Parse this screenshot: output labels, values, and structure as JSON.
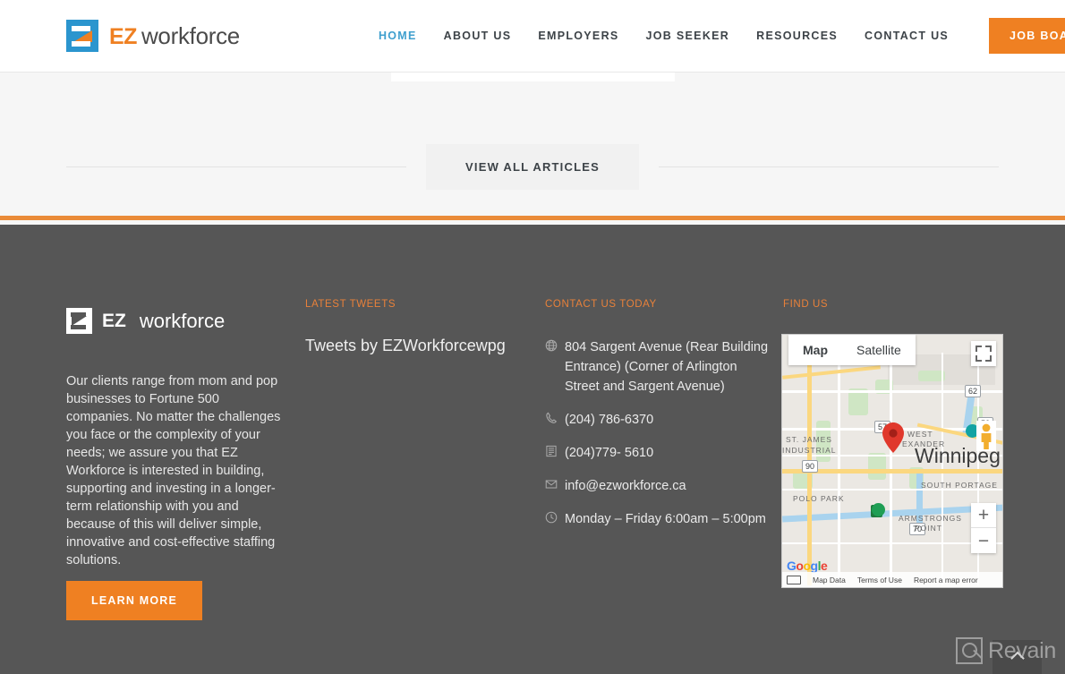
{
  "header": {
    "logo": {
      "ez": "EZ",
      "workforce": "workforce",
      "alt": "EZ Workforce"
    },
    "nav": [
      {
        "label": "HOME",
        "active": true
      },
      {
        "label": "ABOUT US",
        "active": false
      },
      {
        "label": "EMPLOYERS",
        "active": false
      },
      {
        "label": "JOB SEEKER",
        "active": false
      },
      {
        "label": "RESOURCES",
        "active": false
      },
      {
        "label": "CONTACT US",
        "active": false
      }
    ],
    "cta_label": "JOB BOARD"
  },
  "articles": {
    "view_all_label": "VIEW ALL ARTICLES"
  },
  "footer": {
    "logo": {
      "ez": "EZ",
      "workforce": "workforce"
    },
    "about_text": "Our clients range from mom and pop businesses to Fortune 500 companies. No matter the challenges you face or the complexity of your needs; we assure you that EZ Workforce is interested in building, supporting and investing in a longer-term relationship with you and because of this will deliver simple, innovative and cost-effective staffing solutions.",
    "learn_more_label": "LEARN MORE",
    "tweets": {
      "heading": "LATEST TWEETS",
      "feed_label": "Tweets by EZWorkforcewpg"
    },
    "contact": {
      "heading": "CONTACT US TODAY",
      "items": [
        {
          "icon": "globe-icon",
          "text": "804 Sargent Avenue (Rear Building Entrance) (Corner of Arlington Street and Sargent Avenue)"
        },
        {
          "icon": "phone-icon",
          "text": "(204) 786-6370"
        },
        {
          "icon": "fax-icon",
          "text": "(204)779- 5610"
        },
        {
          "icon": "envelope-icon",
          "text": "info@ezworkforce.ca"
        },
        {
          "icon": "clock-icon",
          "text": "Monday – Friday 6:00am – 5:00pm"
        }
      ]
    },
    "find_us": {
      "heading": "FIND US",
      "map": {
        "type_map_label": "Map",
        "type_satellite_label": "Satellite",
        "selected_type": "Map",
        "zoom_in_label": "+",
        "zoom_out_label": "−",
        "attribution_google": "Google",
        "footer_links": [
          "Map Data",
          "Terms of Use",
          "Report a map error"
        ],
        "labels": [
          "ST. JAMES",
          "INDUSTRIAL",
          "WEST",
          "EXANDER",
          "POLO PARK",
          "SOUTH PORTAGE",
          "ARMSTRONGS",
          "POINT",
          "Winnipeg"
        ],
        "route_shields": [
          "62",
          "52",
          "57",
          "90",
          "1",
          "70"
        ]
      }
    }
  },
  "overlay": {
    "watermark_text": "Revain",
    "scroll_top_label": "Back to top"
  },
  "colors": {
    "brand_orange": "#ef8022",
    "brand_blue": "#2b95ce",
    "active_nav": "#3f9fce",
    "footer_bg": "#565656",
    "light_bg": "#f6f6f6"
  }
}
